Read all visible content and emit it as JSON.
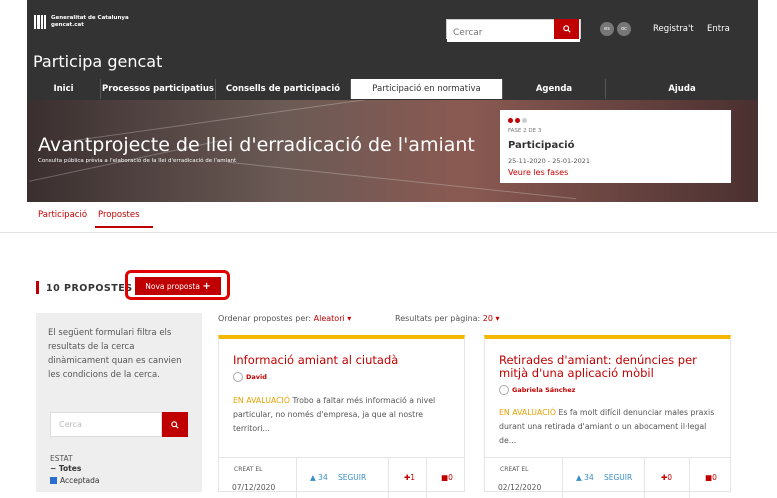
{
  "header": {
    "brand_line1": "Generalitat de Catalunya",
    "brand_line2": "gencat.cat",
    "site_title": "Participa gencat",
    "search_placeholder": "Cercar",
    "lang_es": "es",
    "lang_oc": "oc",
    "register": "Registra't",
    "login": "Entra"
  },
  "nav": [
    {
      "label": "Inici"
    },
    {
      "label": "Processos participatius"
    },
    {
      "label": "Consells de participació"
    },
    {
      "label": "Participació en normativa"
    },
    {
      "label": "Agenda"
    },
    {
      "label": "Ajuda"
    }
  ],
  "hero": {
    "title": "Avantprojecte de llei d'erradicació de l'amiant",
    "subtitle": "Consulta pública prèvia a l'elaboració de la llei d'erradicació de l'amiant",
    "phase_step": "FASE 2 DE 3",
    "phase_name": "Participació",
    "phase_dates": "25-11-2020 - 25-01-2021",
    "phase_link": "Veure les fases"
  },
  "tabs": [
    {
      "label": "Participació"
    },
    {
      "label": "Propostes"
    }
  ],
  "proposals": {
    "count_label": "10 PROPOSTES",
    "new_button": "Nova proposta",
    "new_icon": "+",
    "order_label": "Ordenar propostes per:",
    "order_value": "Aleatori",
    "per_page_label": "Resultats per pàgina:",
    "per_page_value": "20"
  },
  "filter": {
    "description": "El següent formulari filtra els resultats de la cerca dinàmicament quan es canvien les condicions de la cerca.",
    "search_placeholder": "Cerca",
    "state_label": "ESTAT",
    "all_label": "Totes",
    "accepted_label": "Acceptada"
  },
  "cards": [
    {
      "title": "Informació amiant al ciutadà",
      "author": "David",
      "state": "EN AVALUACIÓ",
      "text": "Trobo a faltar més informació a nivel particular, no només d'empresa, ja que al nostre territori...",
      "created_label": "CREAT EL",
      "date": "07/12/2020",
      "supports": "34",
      "follow": "SEGUIR",
      "endorse": "1",
      "comments": "0"
    },
    {
      "title": "Retirades d'amiant: denúncies per mitjà d'una aplicació mòbil",
      "author": "Gabriela Sánchez",
      "state": "EN AVALUACIÓ",
      "text": "Es fa molt difícil denunciar males praxis durant una retirada d'amiant o un abocament il·legal de...",
      "created_label": "CREAT EL",
      "date": "02/12/2020",
      "supports": "34",
      "follow": "SEGUIR",
      "endorse": "0",
      "comments": "0"
    }
  ],
  "colors": {
    "accent": "#c00000",
    "header": "#333333",
    "card_top": "#f5b800",
    "state": "#e8a000"
  }
}
